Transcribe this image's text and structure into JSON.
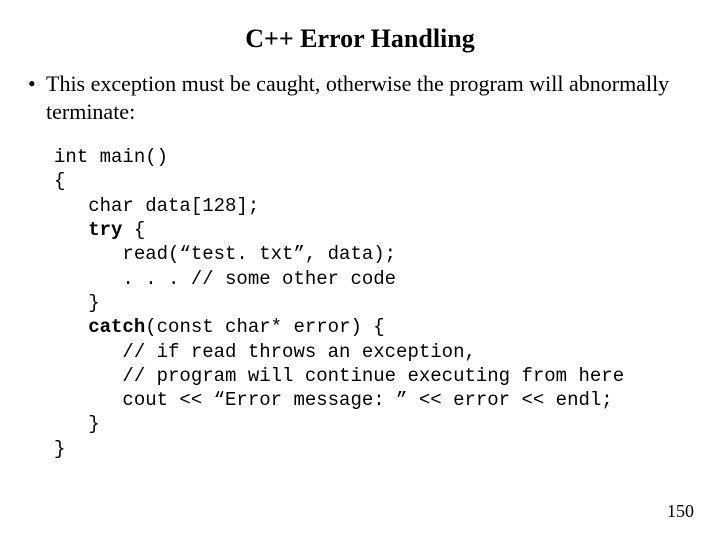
{
  "title": "C++ Error Handling",
  "bullet": "This exception must be caught, otherwise the program will abnormally terminate:",
  "code": {
    "l1": "int main()",
    "l2": "{",
    "l3": "   char data[128];",
    "l4a": "   ",
    "l4b": "try",
    "l4c": " {",
    "l5": "      read(“test. txt”, data);",
    "l6": "      . . . // some other code",
    "l7": "   }",
    "l8a": "   ",
    "l8b": "catch",
    "l8c": "(const char* error) {",
    "l9": "      // if read throws an exception,",
    "l10": "      // program will continue executing from here",
    "l11": "      cout << “Error message: ” << error << endl;",
    "l12": "   }",
    "l13": "}"
  },
  "page_number": "150"
}
